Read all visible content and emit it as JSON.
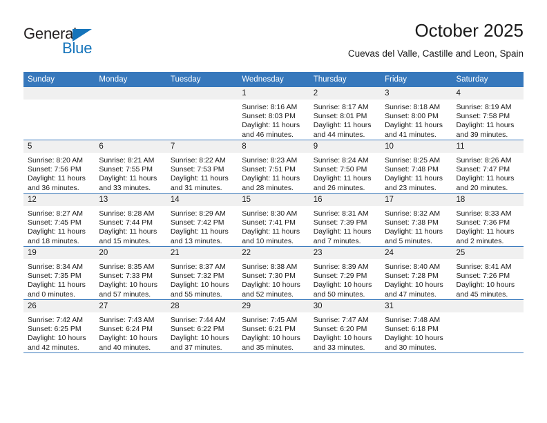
{
  "brand": {
    "name_part1": "General",
    "name_part2": "Blue",
    "triangle_icon": "triangle-icon",
    "color_dark": "#231f20",
    "color_blue": "#1574bb"
  },
  "header": {
    "title": "October 2025",
    "subtitle": "Cuevas del Valle, Castille and Leon, Spain"
  },
  "theme": {
    "header_blue": "#3778bc",
    "daynum_band": "#f0f0f0",
    "text": "#1a1a1a"
  },
  "weekdays": [
    "Sunday",
    "Monday",
    "Tuesday",
    "Wednesday",
    "Thursday",
    "Friday",
    "Saturday"
  ],
  "weeks": [
    [
      {
        "day": "",
        "sunrise": "",
        "sunset": "",
        "daylight1": "",
        "daylight2": ""
      },
      {
        "day": "",
        "sunrise": "",
        "sunset": "",
        "daylight1": "",
        "daylight2": ""
      },
      {
        "day": "",
        "sunrise": "",
        "sunset": "",
        "daylight1": "",
        "daylight2": ""
      },
      {
        "day": "1",
        "sunrise": "Sunrise: 8:16 AM",
        "sunset": "Sunset: 8:03 PM",
        "daylight1": "Daylight: 11 hours",
        "daylight2": "and 46 minutes."
      },
      {
        "day": "2",
        "sunrise": "Sunrise: 8:17 AM",
        "sunset": "Sunset: 8:01 PM",
        "daylight1": "Daylight: 11 hours",
        "daylight2": "and 44 minutes."
      },
      {
        "day": "3",
        "sunrise": "Sunrise: 8:18 AM",
        "sunset": "Sunset: 8:00 PM",
        "daylight1": "Daylight: 11 hours",
        "daylight2": "and 41 minutes."
      },
      {
        "day": "4",
        "sunrise": "Sunrise: 8:19 AM",
        "sunset": "Sunset: 7:58 PM",
        "daylight1": "Daylight: 11 hours",
        "daylight2": "and 39 minutes."
      }
    ],
    [
      {
        "day": "5",
        "sunrise": "Sunrise: 8:20 AM",
        "sunset": "Sunset: 7:56 PM",
        "daylight1": "Daylight: 11 hours",
        "daylight2": "and 36 minutes."
      },
      {
        "day": "6",
        "sunrise": "Sunrise: 8:21 AM",
        "sunset": "Sunset: 7:55 PM",
        "daylight1": "Daylight: 11 hours",
        "daylight2": "and 33 minutes."
      },
      {
        "day": "7",
        "sunrise": "Sunrise: 8:22 AM",
        "sunset": "Sunset: 7:53 PM",
        "daylight1": "Daylight: 11 hours",
        "daylight2": "and 31 minutes."
      },
      {
        "day": "8",
        "sunrise": "Sunrise: 8:23 AM",
        "sunset": "Sunset: 7:51 PM",
        "daylight1": "Daylight: 11 hours",
        "daylight2": "and 28 minutes."
      },
      {
        "day": "9",
        "sunrise": "Sunrise: 8:24 AM",
        "sunset": "Sunset: 7:50 PM",
        "daylight1": "Daylight: 11 hours",
        "daylight2": "and 26 minutes."
      },
      {
        "day": "10",
        "sunrise": "Sunrise: 8:25 AM",
        "sunset": "Sunset: 7:48 PM",
        "daylight1": "Daylight: 11 hours",
        "daylight2": "and 23 minutes."
      },
      {
        "day": "11",
        "sunrise": "Sunrise: 8:26 AM",
        "sunset": "Sunset: 7:47 PM",
        "daylight1": "Daylight: 11 hours",
        "daylight2": "and 20 minutes."
      }
    ],
    [
      {
        "day": "12",
        "sunrise": "Sunrise: 8:27 AM",
        "sunset": "Sunset: 7:45 PM",
        "daylight1": "Daylight: 11 hours",
        "daylight2": "and 18 minutes."
      },
      {
        "day": "13",
        "sunrise": "Sunrise: 8:28 AM",
        "sunset": "Sunset: 7:44 PM",
        "daylight1": "Daylight: 11 hours",
        "daylight2": "and 15 minutes."
      },
      {
        "day": "14",
        "sunrise": "Sunrise: 8:29 AM",
        "sunset": "Sunset: 7:42 PM",
        "daylight1": "Daylight: 11 hours",
        "daylight2": "and 13 minutes."
      },
      {
        "day": "15",
        "sunrise": "Sunrise: 8:30 AM",
        "sunset": "Sunset: 7:41 PM",
        "daylight1": "Daylight: 11 hours",
        "daylight2": "and 10 minutes."
      },
      {
        "day": "16",
        "sunrise": "Sunrise: 8:31 AM",
        "sunset": "Sunset: 7:39 PM",
        "daylight1": "Daylight: 11 hours",
        "daylight2": "and 7 minutes."
      },
      {
        "day": "17",
        "sunrise": "Sunrise: 8:32 AM",
        "sunset": "Sunset: 7:38 PM",
        "daylight1": "Daylight: 11 hours",
        "daylight2": "and 5 minutes."
      },
      {
        "day": "18",
        "sunrise": "Sunrise: 8:33 AM",
        "sunset": "Sunset: 7:36 PM",
        "daylight1": "Daylight: 11 hours",
        "daylight2": "and 2 minutes."
      }
    ],
    [
      {
        "day": "19",
        "sunrise": "Sunrise: 8:34 AM",
        "sunset": "Sunset: 7:35 PM",
        "daylight1": "Daylight: 11 hours",
        "daylight2": "and 0 minutes."
      },
      {
        "day": "20",
        "sunrise": "Sunrise: 8:35 AM",
        "sunset": "Sunset: 7:33 PM",
        "daylight1": "Daylight: 10 hours",
        "daylight2": "and 57 minutes."
      },
      {
        "day": "21",
        "sunrise": "Sunrise: 8:37 AM",
        "sunset": "Sunset: 7:32 PM",
        "daylight1": "Daylight: 10 hours",
        "daylight2": "and 55 minutes."
      },
      {
        "day": "22",
        "sunrise": "Sunrise: 8:38 AM",
        "sunset": "Sunset: 7:30 PM",
        "daylight1": "Daylight: 10 hours",
        "daylight2": "and 52 minutes."
      },
      {
        "day": "23",
        "sunrise": "Sunrise: 8:39 AM",
        "sunset": "Sunset: 7:29 PM",
        "daylight1": "Daylight: 10 hours",
        "daylight2": "and 50 minutes."
      },
      {
        "day": "24",
        "sunrise": "Sunrise: 8:40 AM",
        "sunset": "Sunset: 7:28 PM",
        "daylight1": "Daylight: 10 hours",
        "daylight2": "and 47 minutes."
      },
      {
        "day": "25",
        "sunrise": "Sunrise: 8:41 AM",
        "sunset": "Sunset: 7:26 PM",
        "daylight1": "Daylight: 10 hours",
        "daylight2": "and 45 minutes."
      }
    ],
    [
      {
        "day": "26",
        "sunrise": "Sunrise: 7:42 AM",
        "sunset": "Sunset: 6:25 PM",
        "daylight1": "Daylight: 10 hours",
        "daylight2": "and 42 minutes."
      },
      {
        "day": "27",
        "sunrise": "Sunrise: 7:43 AM",
        "sunset": "Sunset: 6:24 PM",
        "daylight1": "Daylight: 10 hours",
        "daylight2": "and 40 minutes."
      },
      {
        "day": "28",
        "sunrise": "Sunrise: 7:44 AM",
        "sunset": "Sunset: 6:22 PM",
        "daylight1": "Daylight: 10 hours",
        "daylight2": "and 37 minutes."
      },
      {
        "day": "29",
        "sunrise": "Sunrise: 7:45 AM",
        "sunset": "Sunset: 6:21 PM",
        "daylight1": "Daylight: 10 hours",
        "daylight2": "and 35 minutes."
      },
      {
        "day": "30",
        "sunrise": "Sunrise: 7:47 AM",
        "sunset": "Sunset: 6:20 PM",
        "daylight1": "Daylight: 10 hours",
        "daylight2": "and 33 minutes."
      },
      {
        "day": "31",
        "sunrise": "Sunrise: 7:48 AM",
        "sunset": "Sunset: 6:18 PM",
        "daylight1": "Daylight: 10 hours",
        "daylight2": "and 30 minutes."
      },
      {
        "day": "",
        "sunrise": "",
        "sunset": "",
        "daylight1": "",
        "daylight2": ""
      }
    ]
  ]
}
